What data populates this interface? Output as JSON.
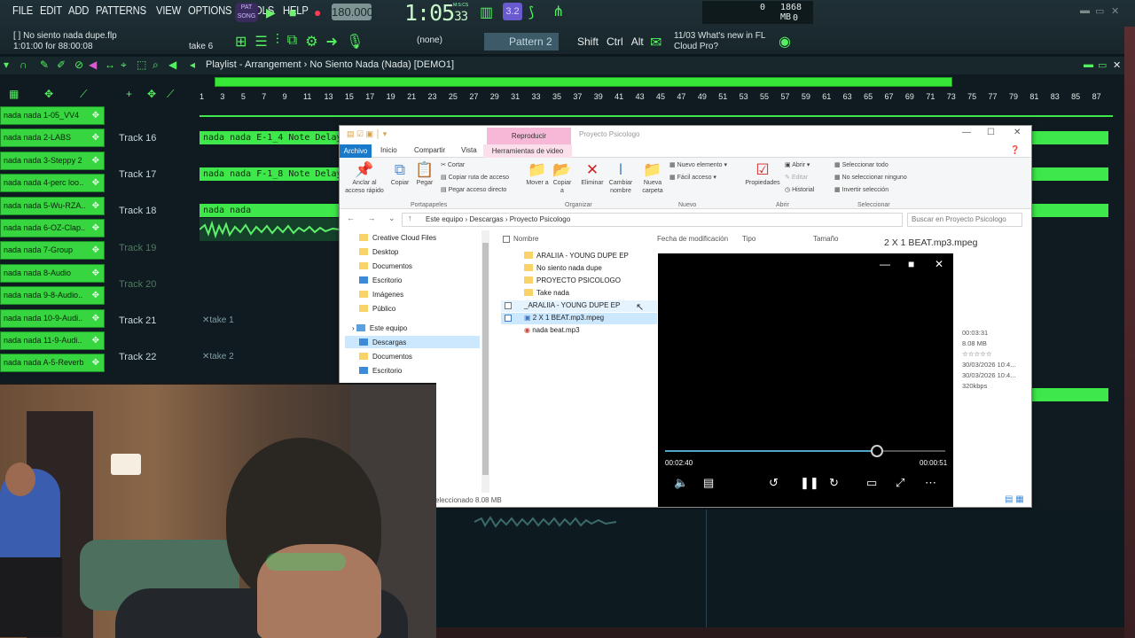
{
  "fl": {
    "menu": [
      "FILE",
      "EDIT",
      "ADD",
      "PATTERNS",
      "VIEW",
      "OPTIONS",
      "TOOLS",
      "HELP"
    ],
    "pat_song": [
      "PAT",
      "SONG"
    ],
    "tempo": "180.000",
    "clock_main": "1:05",
    "clock_small": "33",
    "clock_label": "M:S:CS",
    "mode_badge": "3.2",
    "cpu_value": "0",
    "mem_value": "1868 MB",
    "mem_second": "0",
    "hint_line1": "[ ] No siento nada dupe.flp",
    "hint_line2": "1:01:00 for 88:00:08",
    "take_label": "take 6",
    "none_select": "(none)",
    "pattern_label": "Pattern 2",
    "mods": [
      "Shift",
      "Ctrl",
      "Alt"
    ],
    "news_line1": "11/03  What's new in FL",
    "news_line2": "Cloud Pro?"
  },
  "playlist": {
    "title": "Playlist - Arrangement",
    "sep": "›",
    "song": "No Siento Nada (Nada) [DEMO1]",
    "ruler": [
      "1",
      "3",
      "5",
      "7",
      "9",
      "11",
      "13",
      "15",
      "17",
      "19",
      "21",
      "23",
      "25",
      "27",
      "29",
      "31",
      "33",
      "35",
      "37",
      "39",
      "41",
      "43",
      "45",
      "47",
      "49",
      "51",
      "53",
      "55",
      "57",
      "59",
      "61",
      "63",
      "65",
      "67",
      "69",
      "71",
      "73",
      "75",
      "77",
      "79",
      "81",
      "83",
      "85",
      "87"
    ],
    "channels": [
      "nada nada 1-05_VV4",
      "nada nada 2-LABS",
      "nada nada 3-Steppy 2",
      "nada nada 4-perc loo..",
      "nada nada 5-Wu-RZA..",
      "nada nada 6-OZ-Clap..",
      "nada nada 7-Group",
      "nada nada 8-Audio",
      "nada nada 9-8-Audio..",
      "nada nada 10-9-Audi..",
      "nada nada 11-9-Audi..",
      "nada nada A-5-Reverb"
    ],
    "tracks": [
      "Track 16",
      "Track 17",
      "Track 18",
      "Track 19",
      "Track 20",
      "Track 21",
      "Track 22"
    ],
    "clips": [
      "nada nada E-1_4 Note Delay",
      "nada nada F-1_8 Note Delay",
      "nada nada"
    ],
    "takes": [
      "take 1",
      "take 2"
    ]
  },
  "explorer": {
    "player_tab": "Reproducir",
    "window_title": "Proyecto Psicologo",
    "tabs": [
      "Archivo",
      "Inicio",
      "Compartir",
      "Vista",
      "Herramientas de video"
    ],
    "ribbon": {
      "pin": "Anclar al acceso rápido",
      "copy": "Copiar",
      "paste": "Pegar",
      "cut": "Cortar",
      "copy_path": "Copiar ruta de acceso",
      "paste_link": "Pegar acceso directo",
      "move": "Mover a",
      "copy_to": "Copiar a",
      "delete": "Eliminar",
      "rename": "Cambiar nombre",
      "new_folder": "Nueva carpeta",
      "new_item": "Nuevo elemento",
      "easy_access": "Fácil acceso",
      "properties": "Propiedades",
      "open": "Abrir",
      "edit": "Editar",
      "history": "Historial",
      "select_all": "Seleccionar todo",
      "select_none": "No seleccionar ninguno",
      "invert": "Invertir selección",
      "groups": [
        "Portapapeles",
        "Organizar",
        "Nuevo",
        "Abrir",
        "Seleccionar"
      ]
    },
    "path": "Este equipo  ›  Descargas  ›  Proyecto Psicologo",
    "search_placeholder": "Buscar en Proyecto Psicologo",
    "nav": [
      "Creative Cloud Files",
      "Desktop",
      "Documentos",
      "Escritorio",
      "Imágenes",
      "Público",
      "Este equipo",
      "Descargas",
      "Documentos",
      "Escritorio"
    ],
    "columns": [
      "Nombre",
      "Fecha de modificación",
      "Tipo",
      "Tamaño"
    ],
    "files": [
      "ARALIIA - YOUNG DUPE EP",
      "No siento nada dupe",
      "PROYECTO PSICOLOGO",
      "Take nada",
      "_ARALIIA - YOUNG DUPE EP",
      "2 X 1 BEAT.mp3.mpeg",
      "nada beat.mp3"
    ],
    "preview_title": "2 X 1 BEAT.mp3.mpeg",
    "details": [
      "00:03:31",
      "8.08 MB",
      "☆☆☆☆☆",
      "30/03/2026 10:4...",
      "30/03/2026 10:4...",
      "320kbps"
    ],
    "status": "eleccionado  8.08 MB"
  },
  "player": {
    "elapsed": "00:02:40",
    "remaining": "00:00:51",
    "progress_fraction": 0.757
  }
}
